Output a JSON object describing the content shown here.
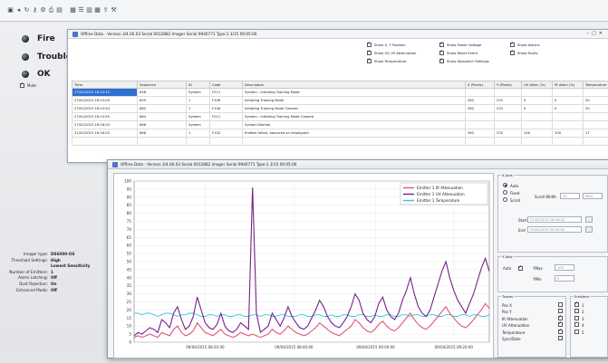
{
  "toolbar": {
    "icons": [
      "app-icon",
      "back-icon",
      "refresh-icon",
      "key-icon",
      "gear-icon",
      "print-icon",
      "open-icon",
      "chart-icon",
      "list-icon",
      "grid-icon",
      "table-icon",
      "export-icon",
      "wrench-icon"
    ]
  },
  "status": [
    {
      "label": "Fire",
      "color": "#1c1f24"
    },
    {
      "label": "Trouble",
      "color": "#1c1f24"
    },
    {
      "label": "OK",
      "color": "#1c1f24"
    }
  ],
  "mute_label": "Mute",
  "device_info": [
    {
      "k": "Imager type:",
      "v": "DS6000-OS"
    },
    {
      "k": "Threshold Settings:",
      "v": "High"
    },
    {
      "k": "",
      "v": "Lowest Sensitivity"
    },
    {
      "k": "Number of Emitters:",
      "v": "1"
    },
    {
      "k": "Alarm Latching:",
      "v": "Off"
    },
    {
      "k": "Dust Rejection:",
      "v": "On"
    },
    {
      "k": "Enhanced Mode:",
      "v": "Off"
    }
  ],
  "win1": {
    "title": "Offline Data - Version 3/4.00.03 Serial 0012882 Imager Serial 9940771 Type:1 3/15 09:05:00",
    "options": [
      "Show X, Y Position",
      "Show Power Voltage",
      "Show Alarms",
      "Show UV, IR Attenuation",
      "Show Reset Event",
      "Show Faults",
      "Show Temperature",
      "Show Dipswitch Settings",
      ""
    ],
    "columns": [
      "Time",
      "Sequence",
      "ID",
      "Code",
      "Description",
      "X (Pixels)",
      "Y (Pixels)",
      "UV Atten (%)",
      "IR Atten (%)",
      "Temperature"
    ],
    "rows": [
      [
        "27/02/2015 16:14:15",
        "858",
        "System",
        "F211",
        "System - Initiating Training Mode",
        "",
        "",
        "",
        "",
        ""
      ],
      [
        "27/02/2015 16:15:00",
        "859",
        "1",
        "F106",
        "Initiating Training Mode",
        "362",
        "232",
        "0",
        "0",
        "20"
      ],
      [
        "27/02/2015 16:15:54",
        "862",
        "1",
        "F106",
        "Initiating Training Mode Cleared",
        "362",
        "232",
        "0",
        "0",
        "20"
      ],
      [
        "27/02/2015 16:15:55",
        "864",
        "System",
        "F211",
        "System - Initiating Training Mode Cleared",
        "",
        "",
        "",
        "",
        ""
      ],
      [
        "27/02/2015 16:16:20",
        "866",
        "System",
        "",
        "System Normal",
        "",
        "",
        "",
        "",
        ""
      ],
      [
        "31/02/2015 16:16:20",
        "868",
        "1",
        "F102",
        "Emitter failed, obscured or misaligned",
        "362",
        "232",
        "100",
        "100",
        "17"
      ]
    ]
  },
  "win2": {
    "title": "Offline Data - Version 3/4.00.03 Serial 0012882 Imager Serial 9940771 Type:1 3/15 09:05:00",
    "x_scale_title": "X Axis",
    "x_modes": [
      "Auto",
      "Fixed",
      "Scroll"
    ],
    "scroll_width_label": "Scroll Width",
    "scroll_width_value": "10",
    "scroll_unit": "Mins",
    "start_label": "Start",
    "start_value": "27/02/2015 16:16:20",
    "end_label": "End",
    "end_value": "09/04/2015 09:30:00",
    "y_axis_title": "Y Axis",
    "y_auto_label": "Auto",
    "ymax_label": "YMax",
    "ymax_value": "100",
    "ymin_label": "YMin",
    "ymin_value": "0",
    "traces_title": "Traces",
    "traces": [
      "Pos X",
      "Pos Y",
      "IR Attenuation",
      "UV Attenuation",
      "Temperature",
      "Sync/Date"
    ],
    "emitters_title": "Emitters",
    "emitters": [
      "1",
      "2",
      "3",
      "4",
      "5"
    ]
  },
  "chart_data": {
    "type": "line",
    "ylim": [
      0,
      100
    ],
    "yticks": [
      0,
      5,
      10,
      15,
      20,
      25,
      30,
      35,
      40,
      45,
      50,
      55,
      60,
      65,
      70,
      75,
      80,
      85,
      90,
      95,
      100
    ],
    "xticks": [
      "09/04/2015 08:20:00",
      "09/04/2015 08:40:00",
      "09/04/2015 09:00:00",
      "09/04/2015 09:20:00"
    ],
    "legend_placement": "top-right",
    "series": [
      {
        "name": "Emitter 1 IR Attenuation",
        "color": "#e0567a",
        "values": [
          3,
          4,
          3,
          4,
          5,
          4,
          3,
          6,
          5,
          4,
          8,
          10,
          6,
          4,
          5,
          7,
          12,
          9,
          6,
          5,
          4,
          6,
          8,
          5,
          4,
          3,
          4,
          6,
          5,
          4,
          5,
          4,
          3,
          4,
          5,
          8,
          6,
          5,
          7,
          10,
          8,
          6,
          5,
          4,
          5,
          7,
          9,
          12,
          10,
          8,
          6,
          5,
          4,
          6,
          8,
          10,
          14,
          12,
          9,
          7,
          6,
          8,
          11,
          13,
          10,
          8,
          7,
          9,
          12,
          15,
          18,
          14,
          11,
          9,
          8,
          10,
          13,
          16,
          19,
          22,
          18,
          15,
          12,
          10,
          9,
          11,
          14,
          17,
          20,
          24,
          21
        ]
      },
      {
        "name": "Emitter 1 UV Attenuation",
        "color": "#7a1f8c",
        "values": [
          4,
          6,
          5,
          7,
          9,
          8,
          6,
          14,
          12,
          9,
          18,
          22,
          14,
          8,
          10,
          16,
          28,
          20,
          12,
          9,
          8,
          11,
          18,
          10,
          7,
          6,
          8,
          12,
          10,
          8,
          96,
          18,
          6,
          8,
          10,
          18,
          14,
          10,
          15,
          22,
          16,
          12,
          9,
          8,
          10,
          15,
          20,
          26,
          22,
          16,
          12,
          10,
          9,
          12,
          16,
          22,
          30,
          26,
          18,
          14,
          12,
          16,
          24,
          28,
          20,
          16,
          14,
          18,
          26,
          32,
          40,
          30,
          22,
          18,
          16,
          20,
          28,
          36,
          44,
          50,
          40,
          32,
          26,
          22,
          18,
          24,
          30,
          38,
          46,
          52,
          44
        ]
      },
      {
        "name": "Emitter 1 Temperature",
        "color": "#37c6dc",
        "values": [
          18,
          18,
          17,
          18,
          18,
          17,
          16,
          17,
          18,
          18,
          17,
          16,
          17,
          17,
          18,
          18,
          17,
          16,
          16,
          17,
          17,
          16,
          17,
          17,
          16,
          16,
          17,
          17,
          16,
          16,
          17,
          17,
          16,
          17,
          17,
          16,
          16,
          17,
          17,
          16,
          16,
          16,
          17,
          17,
          16,
          16,
          17,
          17,
          16,
          16,
          17,
          16,
          16,
          17,
          17,
          16,
          16,
          17,
          17,
          16,
          16,
          17,
          16,
          16,
          17,
          17,
          16,
          16,
          17,
          17,
          16,
          17,
          17,
          16,
          16,
          17,
          17,
          16,
          16,
          17,
          17,
          16,
          16,
          17,
          17,
          16,
          17,
          17,
          16,
          16,
          17
        ]
      }
    ]
  }
}
